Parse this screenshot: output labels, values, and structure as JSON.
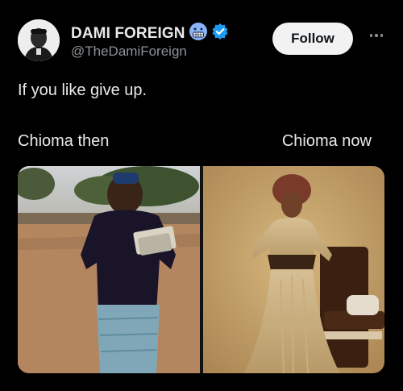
{
  "author": {
    "display_name": "DAMI FOREIGN",
    "handle": "@TheDamiForeign",
    "emoji_badge": "grimacing-face-emoji",
    "verified_badge": "verified-check-icon",
    "verified_color": "#1d9bf0"
  },
  "actions": {
    "follow_label": "Follow",
    "more_icon": "more-horizontal-icon"
  },
  "tweet": {
    "text": "If you like give up.",
    "caption_left": "Chioma then",
    "caption_right": "Chioma now"
  },
  "media": {
    "left_photo": "photo-girl-holding-books-outdoors",
    "right_photo": "photo-woman-in-gold-gown-with-gele"
  },
  "colors": {
    "background": "#000000",
    "text": "#e7e9ea",
    "secondary_text": "#8b9298",
    "follow_bg": "#f2f2f2"
  }
}
